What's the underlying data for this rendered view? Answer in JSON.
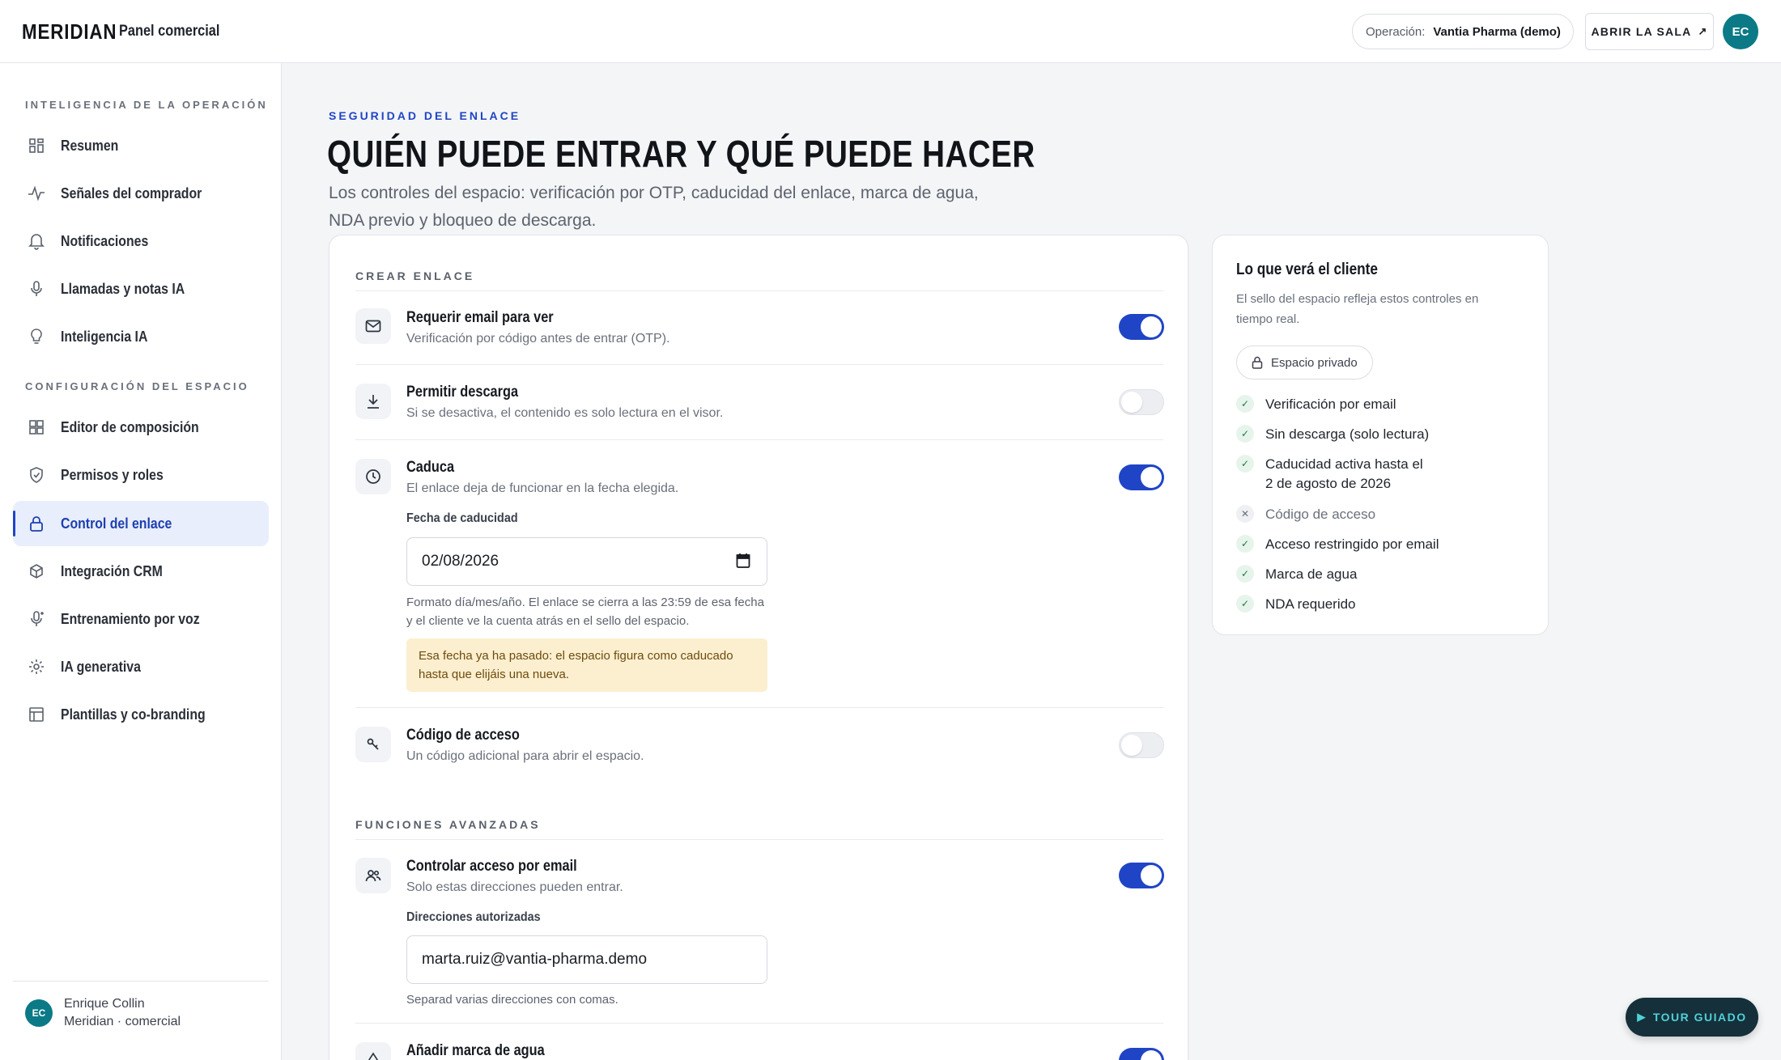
{
  "header": {
    "brand": "MERIDIAN",
    "subtitle": "Panel comercial",
    "operation_label": "Operación:",
    "operation_value": "Vantia Pharma (demo)",
    "open_room": "ABRIR LA SALA",
    "avatar": "EC"
  },
  "sidebar": {
    "section1": "INTELIGENCIA DE LA OPERACIÓN",
    "section2": "CONFIGURACIÓN DEL ESPACIO",
    "items": [
      {
        "label": "Resumen",
        "icon": "grid-icon"
      },
      {
        "label": "Señales del comprador",
        "icon": "pulse-icon"
      },
      {
        "label": "Notificaciones",
        "icon": "bell-icon"
      },
      {
        "label": "Llamadas y notas IA",
        "icon": "mic-icon"
      },
      {
        "label": "Inteligencia IA",
        "icon": "lightbulb-icon"
      },
      {
        "label": "Editor de composición",
        "icon": "layout-icon"
      },
      {
        "label": "Permisos y roles",
        "icon": "shield-icon"
      },
      {
        "label": "Control del enlace",
        "icon": "lock-icon",
        "active": true
      },
      {
        "label": "Integración CRM",
        "icon": "cube-icon"
      },
      {
        "label": "Entrenamiento por voz",
        "icon": "voice-icon"
      },
      {
        "label": "IA generativa",
        "icon": "sparkle-icon"
      },
      {
        "label": "Plantillas y co-branding",
        "icon": "template-icon"
      }
    ],
    "user": {
      "initials": "EC",
      "name": "Enrique Collin",
      "role": "Meridian · comercial"
    }
  },
  "main": {
    "eyebrow": "SEGURIDAD DEL ENLACE",
    "title": "QUIÉN PUEDE ENTRAR Y QUÉ PUEDE HACER",
    "description": "Los controles del espacio: verificación por OTP, caducidad del enlace, marca de agua, NDA previo y bloqueo de descarga.",
    "create_link": {
      "title": "CREAR ENLACE",
      "require_email": {
        "title": "Requerir email para ver",
        "sub": "Verificación por código antes de entrar (OTP).",
        "on": true
      },
      "allow_download": {
        "title": "Permitir descarga",
        "sub": "Si se desactiva, el contenido es solo lectura en el visor.",
        "on": false
      },
      "expires": {
        "title": "Caduca",
        "sub": "El enlace deja de funcionar en la fecha elegida.",
        "on": true,
        "date_label": "Fecha de caducidad",
        "date_value": "02/08/2026",
        "help": "Formato día/mes/año. El enlace se cierra a las 23:59 de esa fecha y el cliente ve la cuenta atrás en el sello del espacio.",
        "warning": "Esa fecha ya ha pasado: el espacio figura como caducado hasta que elijáis una nueva."
      },
      "access_code": {
        "title": "Código de acceso",
        "sub": "Un código adicional para abrir el espacio.",
        "on": false
      }
    },
    "advanced": {
      "title": "FUNCIONES AVANZADAS",
      "email_control": {
        "title": "Controlar acceso por email",
        "sub": "Solo estas direcciones pueden entrar.",
        "on": true,
        "field_label": "Direcciones autorizadas",
        "value": "marta.ruiz@vantia-pharma.demo",
        "help": "Separad varias direcciones con comas."
      },
      "watermark": {
        "title": "Añadir marca de agua",
        "on": true
      }
    }
  },
  "preview": {
    "title": "Lo que verá el cliente",
    "description": "El sello del espacio refleja estos controles en tiempo real.",
    "badge": "Espacio privado",
    "checks": [
      {
        "text": "Verificación por email",
        "ok": true
      },
      {
        "text": "Sin descarga (solo lectura)",
        "ok": true
      },
      {
        "text": "Caducidad activa hasta el",
        "text2": "2 de agosto de 2026",
        "ok": true
      },
      {
        "text": "Código de acceso",
        "ok": false
      },
      {
        "text": "Acceso restringido por email",
        "ok": true
      },
      {
        "text": "Marca de agua",
        "ok": true
      },
      {
        "text": "NDA requerido",
        "ok": true
      }
    ]
  },
  "tour": "TOUR GUIADO",
  "colors": {
    "accent": "#1f45c6",
    "teal": "#0b7a86",
    "warning_bg": "#fbefcf"
  }
}
